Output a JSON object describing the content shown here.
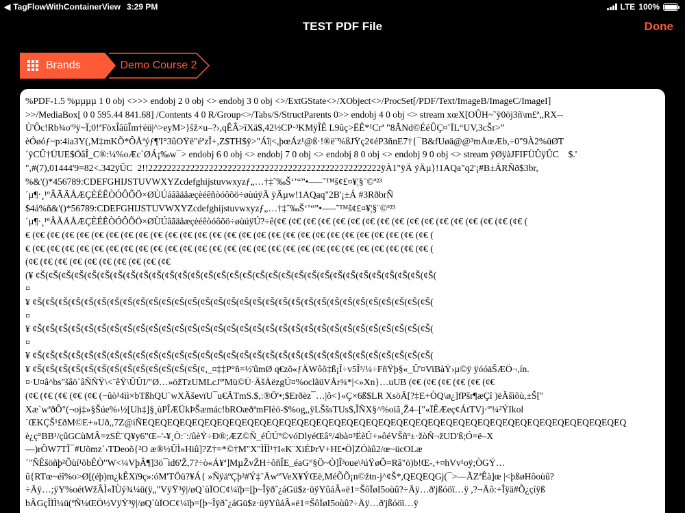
{
  "status_bar": {
    "back_app": "TagFlowWithContainerView",
    "time": "3:29 PM",
    "carrier": "LTE",
    "battery": "100%",
    "battery_level": 1.0
  },
  "nav": {
    "title": "TEST PDF File",
    "done_label": "Done"
  },
  "breadcrumb": {
    "brands_label": "Brands",
    "course_label": "Demo Course 2"
  },
  "pdf_lines": [
    "%PDF-1.5 %µµµµ 1 0 obj <>>> endobj 2 0 obj <> endobj 3 0 obj <>/ExtGState<>/XObject<>/ProcSet[/PDF/Text/ImageB/ImageC/ImageI]",
    ">>/MediaBox[ 0 0 595.44 841.68] /Contents 4 0 R/Group<>/Tabs/S/StructParents 0>> endobj 4 0 obj <> stream xœX[OÛH~˜ÿ0öj3ñ\\m£ª,,RX--",
    "Ù'Ôc!Rb¾oº³ÿ~Ï;0!ªFöxÎâûÎm†éü|^>eyM>}šž×u–?›,qÊÂ>îXä$,42½CP·³KMÿÎÊ L9ûç>ËÊ*¹Crª \"8ÃNd©ÉéÛÇ¤¨ÏL“UV,3cŠr>”",
    "èÓøóƒ~p:4ia3Y(,M‡mKÕ*ÔÅªýƒ¶'I°3ûOŸë\"éªzÎ+,Z$TH$ÿ>\"Áî|<,þœÁz¹@ß·!®ë¨%ßJŸç2¢éP3ñnE7†{¯B&fUøä@@³mÄœÆb,÷0\"9À2%üØT",
    "´ÿCÛ†ÜUE$ÖâÎ_C®:¼%oÆc`ØÁ¡‰w¯> endobj 6 0 obj <> endobj 7 0 obj <> endobj 8 0 obj <> endobj 9 0 obj <> stream ÿØÿàJFIFÜÛÿÛC    $.'",
    "\",#(7),01444'9=82<.342ÿÛC  2!!22222222222222222222222222222222222222222222222222ÿÀ1\"ÿÄ ÿÄµ}!1AQa\"q2'¡#B±ÁRÑð$3br,",
    "%&'()*456789:CDEFGHIJSTUVWXYZcdefghijstuvwxyzƒ„…†‡ˆ‰Š‘’“”•–—˜™š¢£¤¥¦§¨©ª²³",
    "´µ¶·¸¹ºÂÃÄÅÆÇÈÉÊÒÓÔÕÖ×ØÙÚáâãäåæçèéêñòóôõö÷øùúÿÄ ÿÄµw!1AQaq\"2B'¡±Á #3RðbrÑ",
    "$4á%ñ&'()*56789:CDEFGHIJSTUVWXYZcdefghijstuvwxyzƒ„…†‡ˆ‰Š‘’“”•–—˜™š¢£¤¥¦§¨©ª²³",
    "´µ¶·¸¹ºÂÃÄÅÆÇÈÉÊÒÓÔÕÖ×ØÙÚâãäåæçèéêòóôõö÷øùúÿÚ?÷ê(¢€ (¢€ (¢€ (¢€ (¢€ (¢€ (¢€ (¢€ (¢€ (¢€ (¢€ (¢€ (¢€ (¢€ (¢€ (¢€ (¢€ (",
    "€ (¢€ (¢€ (¢€ (¢€ (¢€ (¢€ (¢€ (¢€ (¢€ (¢€ (¢€ (¢€ (¢€ (¢€ (¢€ (¢€ (¢€ (¢€ (¢€ (¢€ (¢€ (¢€ (¢€ (¢€ (¢€ (¢€ (¢€ (",
    "€ (¢€ (¢€ (¢€ (¢€ (¢€ (¢€ (¢€ (¢€ (¢€ (¢€ (¢€ (¢€ (¢€ (¢€ (¢€ (¢€ (¢€ (¢€ (¢€ (¢€ (¢€ (¢€ (¢€ (¢€ (¢€ (¢€ (¢€ (",
    "(¢€ (¢€ (¢€ (¢€ (¢€ (¢€ (¢€ (¢€ (¢€ (¢€",
    "(¥ ¢Š(¢Š(¢Š(¢Š(¢Š(¢Š(¢Š(¢Š(¢Š(¢Š(¢Š(¢Š(¢Š(¢Š(¢Š(¢Š(¢Š(¢Š(¢Š(¢Š(¢Š(¢Š(¢Š(¢Š(¢Š(¢Š(¢Š(¢Š(¢Š(¢Š(¢Š(",
    "¤",
    "¥ ¢Š(¢Š(¢Š(¢Š(¢Š(¢Š(¢Š(¢Š(¢Š(¢Š(¢Š(¢Š(¢Š(¢Š(¢Š(¢Š(¢Š(¢Š(¢Š(¢Š(¢Š(¢Š(¢Š(¢Š(¢Š(¢Š(¢Š(¢Š(¢Š(¢Š(¢Š(",
    "¤",
    "¥ ¢Š(¢Š(¢Š(¢Š(¢Š(¢Š(¢Š(¢Š(¢Š(¢Š(¢Š(¢Š(¢Š(¢Š(¢Š(¢Š(¢Š(¢Š(¢Š(¢Š(¢Š(¢Š(¢Š(¢Š(¢Š(¢Š(¢Š(¢Š(¢Š(¢Š(¢Š(",
    "¤",
    "¥ ¢Š(¢Š(¢Š(¢Š(¢Š(¢Š(¢Š(¢Š(¢Š(¢Š(¢Š(¢Š(¢Š(¢Š(¢Š(¢Š(¢Š(¢Š(¢Š(¢Š(¢Š(¢Š(¢Š(¢Š(¢Š(¢Š(¢Š(¢Š(¢Š(¢Š(¢Š(",
    "¥ ¢Š(¢Š(¢Š(¢Š(¢Š(¢Š(¢Š(¢Š(¢Š(¢Š(¢Š(¢Š(¢Š(¢,_¤‡‡P°ñ=½'ûmØ q€zõ«ƒÄWôõ‡ß¡Î÷v5Î³/¼÷FñŸþ§«_Û'¤ViBàŸ›µ©ÿ ÿóóäŠÆÖ¬,ín.",
    "¤·U¤â^bs\"šâö`âÑÑŸ\\<¨êŸ\\ÛÛI/\"Ø…»öžTzUMLcJº'Mü©Ü·ÄšÄëzgÚ¤%oclãüVÅr¾*|<»Xn}…uUB (¢€ (¢€ (¢€ (¢€ (¢€ (¢€",
    "(¢€ (¢€ (¢€ (¢€ (¢€ (−ûò¹4ìì×bTßhQU`wXÄševïU¯u€ÄTmS.$,:®Ö'•;$Erðëz¯…|ô<}«Ç×6ß$LR XsöÄ[?‡E+ÒQ\\ø¿]fPšr¶æÇî )ëÄšìõù,±Š[\"",
    "Xæ`wªðÕ\"(¬oj‡»§Šúe%›½[Uh‡]§¸ùPÎÆÜkÞŠæmác!bROæðªmFIèö-$%og,,ÿLŠšsTUs$,ÎÑX§^%oiã¸Ž4–[\"«ÏÊÆeç¢ÁtTVj·º'¼²ÝIkol",
    "´ŒKÇŠ¹£ðM©E+»Uð,,7Z@iÑEQEQEQEQEQEQEQEQEQEQEQEQEQEQEQEQEQEQEQEQEQEQEQEQEQEQEQEQEQEQEQEQEQEQEQEQEQEQEQ",
    "è¿ç°BB¹/çûGCùMÂ=zSË¨Q¥y6\"Œ–'-¥¸Ò:¨:/ûèŸ÷Ð®;ÆZ©Ñ_éÛÚº©vóDlyéŒâ°/4bà¤³ËèÛ+»ôéVŠñº±·žòÑ¬žUD'ß;Ó=ë–X",
    "—)rÔW7TÎ¯#Uõmz`›TDeoõ{²O æ®½ÛÌ»Hiû]?Z†=*©†M\"X\"ÌÎÌ¹†I«K¨XiÉÞrV+H£•Ö]ZÓàû2/œ~ücOLæ",
    "´\"ÑÊšöñþ²Õùí¹õbÊÒ\"W<¼VþÂ¶]3ö¯ìd6'Ž,7?÷ò«Á¥ª]MµŽvŽH÷ôñÎE_éaG°§Ö~Ò]Î³oue\\²úŸøÕ=Râ\"ö)b!Œ-,+¤hVv¹oÿ;ÒGÝ…",
    "û{RTœ~éî%o>Ø[(éþ)m¿kÊXï9ç»:óM'TÖü?¥Á{ »ÑÿäºÇþ²#Ý‡¨Äwº'VeX¥ÝŒë,MéÕÕ¡n©žŧn-j^¢Š*,QEQEQGj(¯>—ÃZªÊà]œ |<þßøHôoùû?",
    "÷Äÿ…;ÿY%oétWžÂÌ«ÏÙý¾¼ü(ÿ„\"VÿŸ³ÿ|/øQ`ùÏOC¢¼ïþ=[þ~Îÿðˆ¿áGü$z·üÿYûáÂ«ë1=ŠôÏøI5oùû?÷Äÿ…ð'jßóöï…ÿ ,?¬Äô:+Îÿä#Õ¿çíÿß",
    "bÂGçÎÏÌ¼ü(ºÑ¼ŒÖ½VÿŸ³ÿ|/øQ`ùÏOC¢¼ïþ=[þ~Îÿðˆ¿áGü$z·üÿYûáÂ«ë1=ŠôÏøI5oùû?÷Äÿ…ð'jßóöï…ÿ"
  ]
}
